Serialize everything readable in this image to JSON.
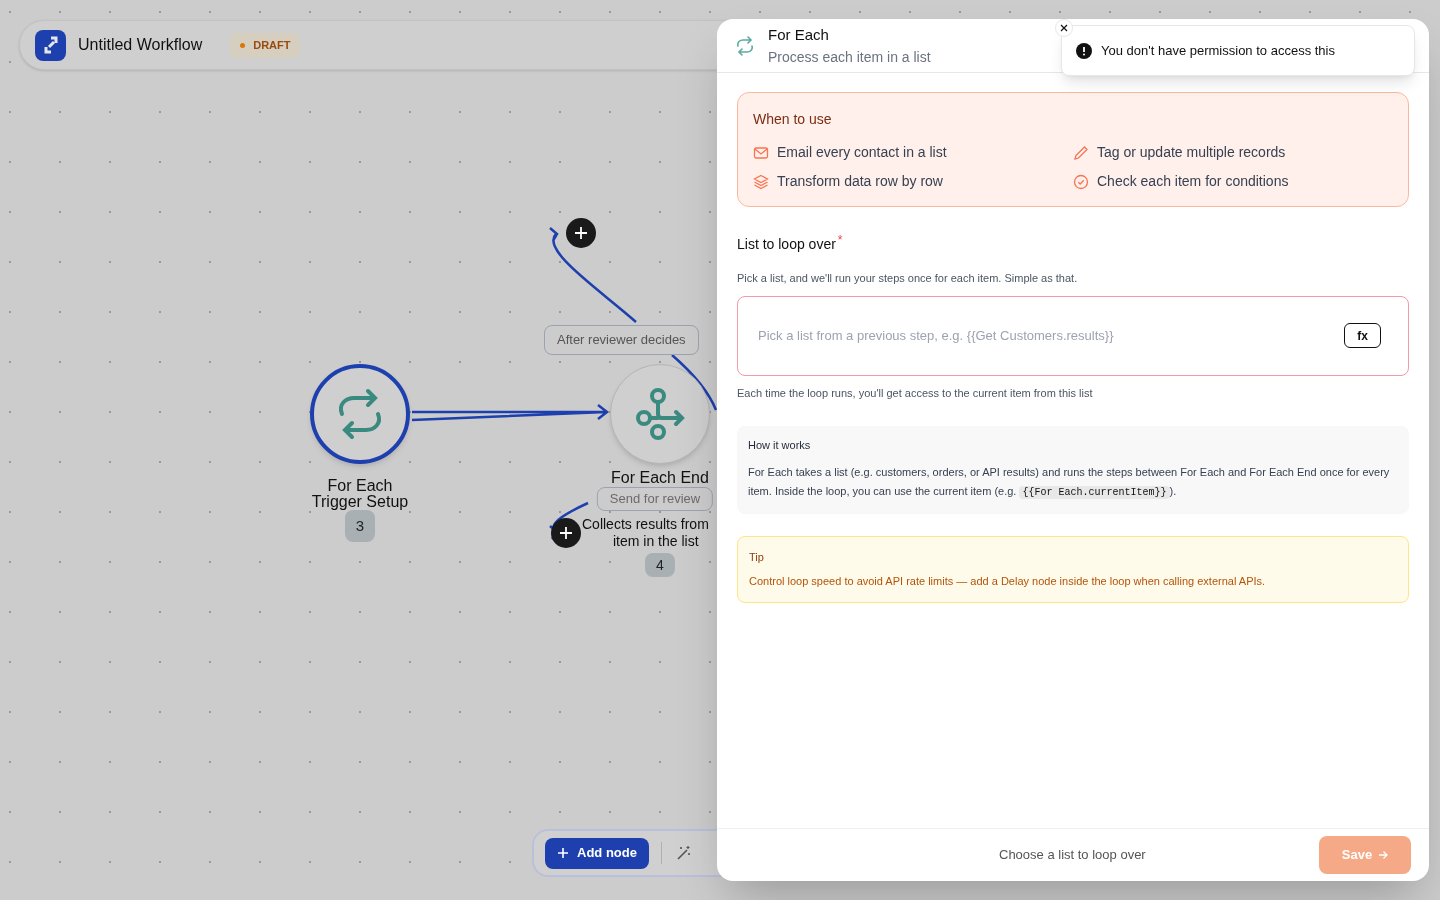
{
  "workflow": {
    "title": "Untitled Workflow",
    "status": "DRAFT"
  },
  "canvas": {
    "nodes": [
      {
        "kind": "loop",
        "selected": true,
        "label": "For Each",
        "sublabel": "Trigger Setup",
        "badge": "3"
      },
      {
        "kind": "branch",
        "selected": false,
        "label": "For Each End",
        "pill": "Send for review",
        "description": [
          "Collects results from",
          "item in the list"
        ],
        "badge": "4"
      }
    ],
    "edge_label": "After reviewer decides"
  },
  "toolbar": {
    "add_button": "Add node"
  },
  "panel": {
    "title": "For Each",
    "subtitle": "Process each item in a list",
    "when_to_use": {
      "heading": "When to use",
      "items": [
        {
          "kind": "mail",
          "text": "Email every contact in a list"
        },
        {
          "kind": "pencil",
          "text": "Tag or update multiple records"
        },
        {
          "kind": "layers",
          "text": "Transform data row by row"
        },
        {
          "kind": "check",
          "text": "Check each item for conditions"
        }
      ]
    },
    "field": {
      "label": "List to loop over",
      "required_mark": "*",
      "help": "Pick a list, and we'll run your steps once for each item. Simple as that.",
      "placeholder": "Pick a list from a previous step, e.g. {{Get Customers.results}}",
      "fx": "fx",
      "invalid": true,
      "note": "Each time the loop runs, you'll get access to the current item from this list"
    },
    "how": {
      "heading": "How it works",
      "before": "For Each takes a list (e.g. customers, orders, or API results) and runs the steps between For Each and For Each End once for every item. Inside the loop, you can use the current item (e.g. ",
      "code": "{{For Each.currentItem}}",
      "after": ")."
    },
    "tip": {
      "heading": "Tip",
      "text": "Control loop speed to avoid API rate limits — add a Delay node inside the loop when calling external APIs."
    },
    "footer": {
      "hint": "Choose a list to loop over",
      "save": "Save"
    }
  },
  "toast": {
    "message": "You don't have permission to access this"
  }
}
